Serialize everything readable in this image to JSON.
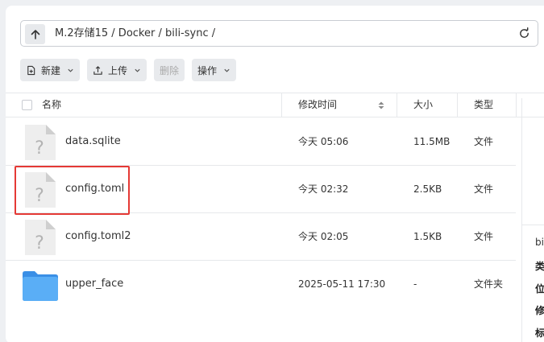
{
  "address": {
    "path": "M.2存储15 / Docker / bili-sync /"
  },
  "toolbar": {
    "new_label": "新建",
    "upload_label": "上传",
    "delete_label": "删除",
    "action_label": "操作"
  },
  "table": {
    "headers": {
      "name": "名称",
      "modified": "修改时间",
      "size": "大小",
      "type": "类型"
    },
    "rows": [
      {
        "name": "data.sqlite",
        "modified": "今天 05:06",
        "size": "11.5MB",
        "type": "文件",
        "icon": "unknown-file-icon"
      },
      {
        "name": "config.toml",
        "modified": "今天 02:32",
        "size": "2.5KB",
        "type": "文件",
        "icon": "unknown-file-icon"
      },
      {
        "name": "config.toml2",
        "modified": "今天 02:05",
        "size": "1.5KB",
        "type": "文件",
        "icon": "unknown-file-icon"
      },
      {
        "name": "upper_face",
        "modified": "2025-05-11 17:30",
        "size": "-",
        "type": "文件夹",
        "icon": "folder-icon"
      }
    ]
  },
  "details": {
    "name": "bili",
    "type_label": "类型",
    "location_label": "位置",
    "modified_label": "修改",
    "tags_label": "标签"
  },
  "colors": {
    "highlight": "#e53935",
    "folder": "#3f9cf0"
  }
}
